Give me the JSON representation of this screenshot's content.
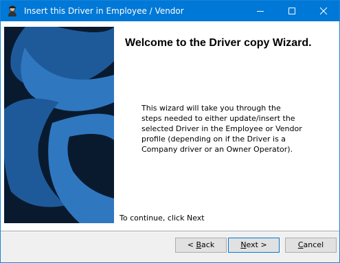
{
  "window": {
    "title": "Insert this Driver in Employee / Vendor",
    "controls": {
      "minimize_icon": "minimize-icon",
      "maximize_icon": "maximize-icon",
      "close_icon": "close-icon"
    },
    "accent_color": "#0078d7"
  },
  "wizard": {
    "heading": "Welcome to the Driver copy Wizard.",
    "intro": "This wizard will take you through the steps needed to either update/insert the selected Driver in the Employee or Vendor profile (depending on if the Driver is a Company driver or an Owner Operator).",
    "continue_hint": "To continue, click Next",
    "banner_colors": {
      "dark": "#0a1a2e",
      "mid": "#1e5a9a",
      "light": "#2f78c0"
    }
  },
  "buttons": {
    "back": {
      "prefix": "< ",
      "accel": "B",
      "rest": "ack"
    },
    "next": {
      "prefix": "",
      "accel": "N",
      "rest": "ext >"
    },
    "cancel": {
      "prefix": "",
      "accel": "C",
      "rest": "ancel"
    }
  }
}
